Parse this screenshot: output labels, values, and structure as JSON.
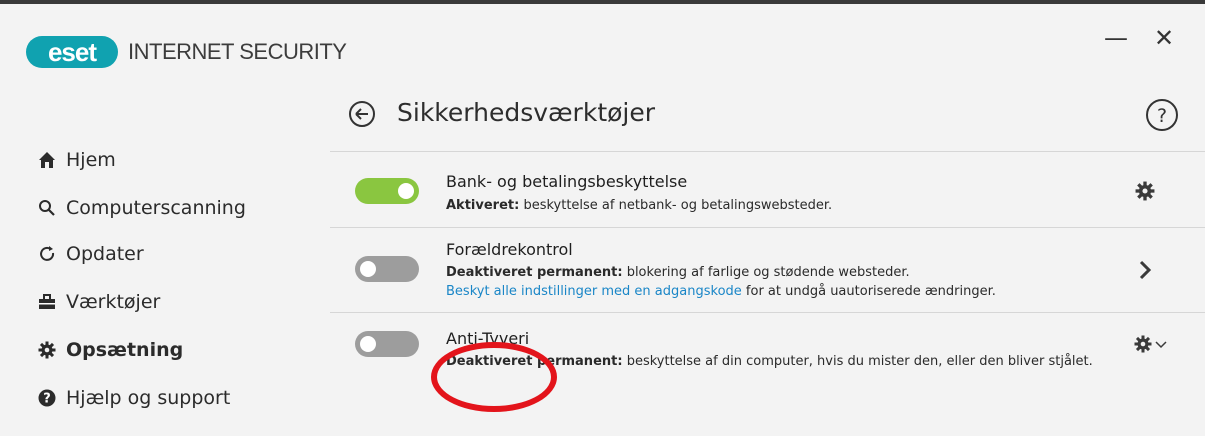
{
  "app": {
    "logo_text": "eset",
    "product_name": "INTERNET SECURITY",
    "brand_color": "#10a2b0"
  },
  "window_controls": {
    "minimize_icon": "minimize-icon",
    "minimize_glyph": "—",
    "close_icon": "close-icon",
    "close_glyph": "✕"
  },
  "sidebar": {
    "items": [
      {
        "label": "Hjem",
        "icon": "home-icon",
        "active": false
      },
      {
        "label": "Computerscanning",
        "icon": "search-icon",
        "active": false
      },
      {
        "label": "Opdater",
        "icon": "refresh-icon",
        "active": false
      },
      {
        "label": "Værktøjer",
        "icon": "toolbox-icon",
        "active": false
      },
      {
        "label": "Opsætning",
        "icon": "gear-icon",
        "active": true
      },
      {
        "label": "Hjælp og support",
        "icon": "help-circle-icon",
        "active": false
      }
    ]
  },
  "header": {
    "title": "Sikkerhedsværktøjer",
    "back_icon": "back-arrow-icon",
    "help_icon": "help-icon"
  },
  "tools": [
    {
      "name": "Bank- og betalingsbeskyttelse",
      "status_label": "Aktiveret:",
      "description": " beskyttelse af netbank- og betalingswebsteder.",
      "enabled": true,
      "action_icon": "gear-icon"
    },
    {
      "name": "Forældrekontrol",
      "status_label": "Deaktiveret permanent:",
      "description": " blokering af farlige og stødende websteder.",
      "link_text": "Beskyt alle indstillinger med en adgangskode",
      "link_suffix": " for at undgå uautoriserede ændringer.",
      "enabled": false,
      "action_icon": "chevron-right-icon"
    },
    {
      "name": "Anti-Tyveri",
      "status_label": "Deaktiveret permanent:",
      "description": " beskyttelse af din computer, hvis du mister den, eller den bliver stjålet.",
      "enabled": false,
      "action_icon": "gear-dropdown-icon"
    }
  ],
  "colors": {
    "toggle_on": "#8ac640",
    "toggle_off": "#9d9d9d",
    "link": "#1a86c7",
    "annotation": "#e3141b"
  }
}
